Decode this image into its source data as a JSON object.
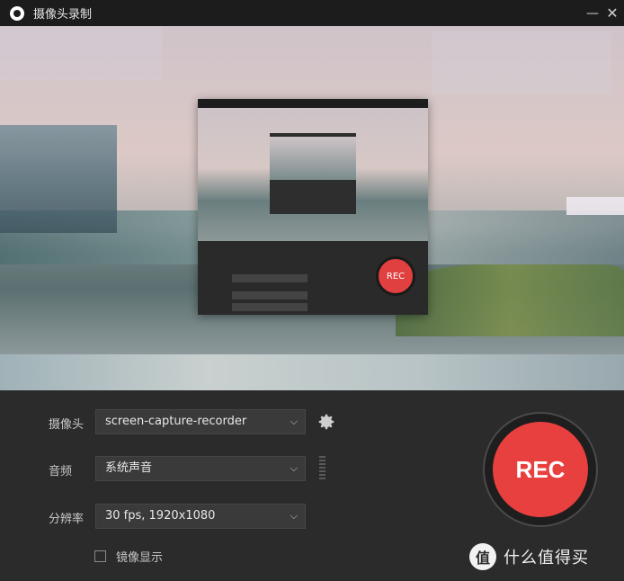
{
  "window": {
    "title": "摄像头录制",
    "minimize_glyph": "—",
    "close_glyph": "✕"
  },
  "preview": {
    "nested_window": {
      "rec_label": "REC"
    }
  },
  "controls": {
    "camera": {
      "label": "摄像头",
      "value": "screen-capture-recorder"
    },
    "audio": {
      "label": "音频",
      "value": "系统声音"
    },
    "resolution": {
      "label": "分辨率",
      "value": "30 fps, 1920x1080"
    },
    "mirror": {
      "label": "镜像显示",
      "checked": false
    }
  },
  "record_button": {
    "label": "REC",
    "color": "#e8403f"
  },
  "watermark": {
    "text": "什么值得买",
    "icon_text": "值"
  }
}
